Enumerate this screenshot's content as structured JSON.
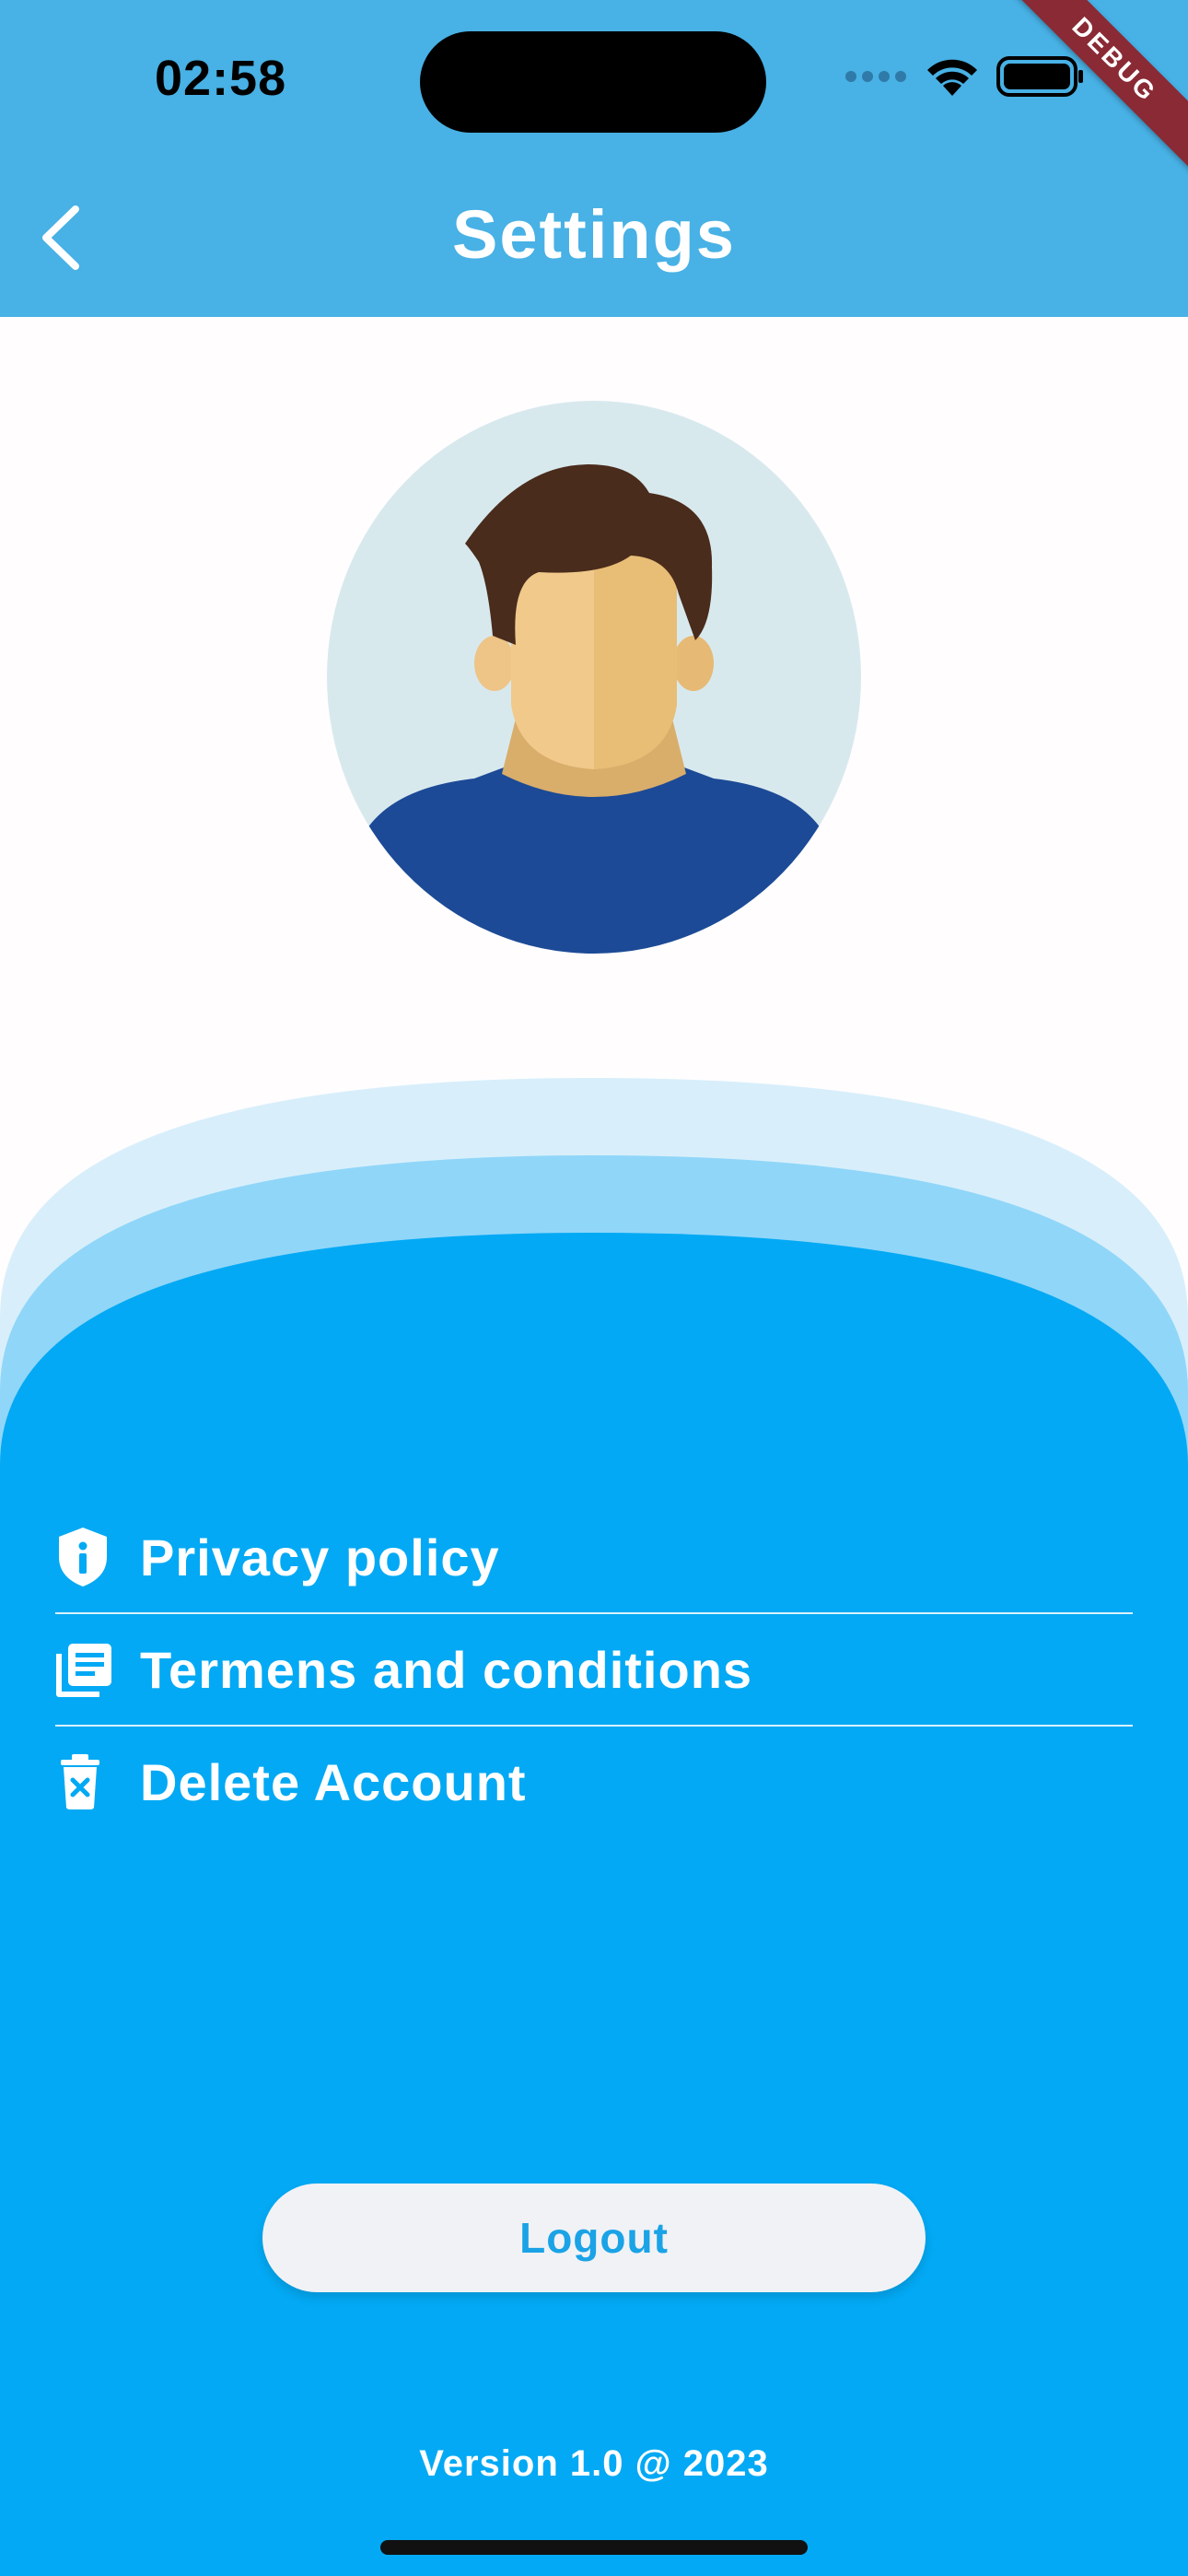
{
  "status_bar": {
    "time": "02:58",
    "icons": [
      "signal-dots-icon",
      "wifi-icon",
      "battery-icon"
    ]
  },
  "debug_banner": "DEBUG",
  "app_bar": {
    "title": "Settings",
    "back_icon": "chevron-left-icon"
  },
  "profile": {
    "avatar": "user-avatar-illustration"
  },
  "menu": {
    "items": [
      {
        "label": "Privacy policy",
        "icon": "shield-info-icon"
      },
      {
        "label": "Termens and conditions",
        "icon": "document-stack-icon"
      },
      {
        "label": "Delete Account",
        "icon": "trash-x-icon"
      }
    ]
  },
  "logout": {
    "label": "Logout"
  },
  "footer": {
    "version": "Version 1.0 @ 2023"
  },
  "colors": {
    "appbar": "#48b1e5",
    "main_blue": "#03a9f4",
    "wave_mid": "#90d6f9",
    "wave_light": "#d8effb",
    "logout_text": "#1aa3e6",
    "logout_bg": "#f1f2f5"
  }
}
